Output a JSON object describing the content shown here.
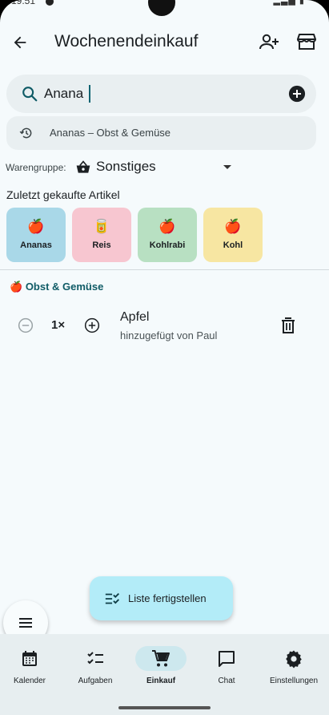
{
  "status_bar": {
    "time": "19:51"
  },
  "app_bar": {
    "title": "Wochenendeinkauf",
    "back_icon": "arrow-back-icon",
    "add_person_icon": "person-add-icon",
    "store_icon": "storefront-icon"
  },
  "search": {
    "value": "Anana",
    "placeholder": "",
    "icon": "search-icon",
    "add_icon": "add-circle-icon"
  },
  "suggestion": {
    "icon": "history-icon",
    "text": "Ananas – Obst & Gemüse"
  },
  "product_group": {
    "label": "Warengruppe:",
    "value": "Sonstiges",
    "icon": "shopping-basket-icon"
  },
  "recent": {
    "title": "Zuletzt gekaufte Artikel",
    "items": [
      {
        "label": "Ananas",
        "emoji": "🍎",
        "color": "#a9d8e8"
      },
      {
        "label": "Reis",
        "emoji": "🥫",
        "color": "#f7c6d0"
      },
      {
        "label": "Kohlrabi",
        "emoji": "🍎",
        "color": "#b8e0c2"
      },
      {
        "label": "Kohl",
        "emoji": "🍎",
        "color": "#f7e6a2"
      }
    ]
  },
  "section": {
    "emoji": "🍎",
    "title": "Obst & Gemüse",
    "items": [
      {
        "quantity": "1×",
        "name": "Apfel",
        "added_by": "hinzugefügt von Paul"
      }
    ]
  },
  "finish_button": {
    "label": "Liste fertigstellen",
    "icon": "checklist-icon"
  },
  "menu_fab": {
    "icon": "menu-icon"
  },
  "bottom_nav": {
    "active": "Einkauf",
    "items": [
      {
        "label": "Kalender",
        "icon": "calendar-icon"
      },
      {
        "label": "Aufgaben",
        "icon": "checklist-icon"
      },
      {
        "label": "Einkauf",
        "icon": "cart-icon"
      },
      {
        "label": "Chat",
        "icon": "chat-icon"
      },
      {
        "label": "Einstellungen",
        "icon": "gear-icon"
      }
    ]
  },
  "colors": {
    "accent": "#0f5b66",
    "background": "#f5fafc",
    "finish_button": "#b3ecf8",
    "nav_active": "#cde8ee"
  }
}
